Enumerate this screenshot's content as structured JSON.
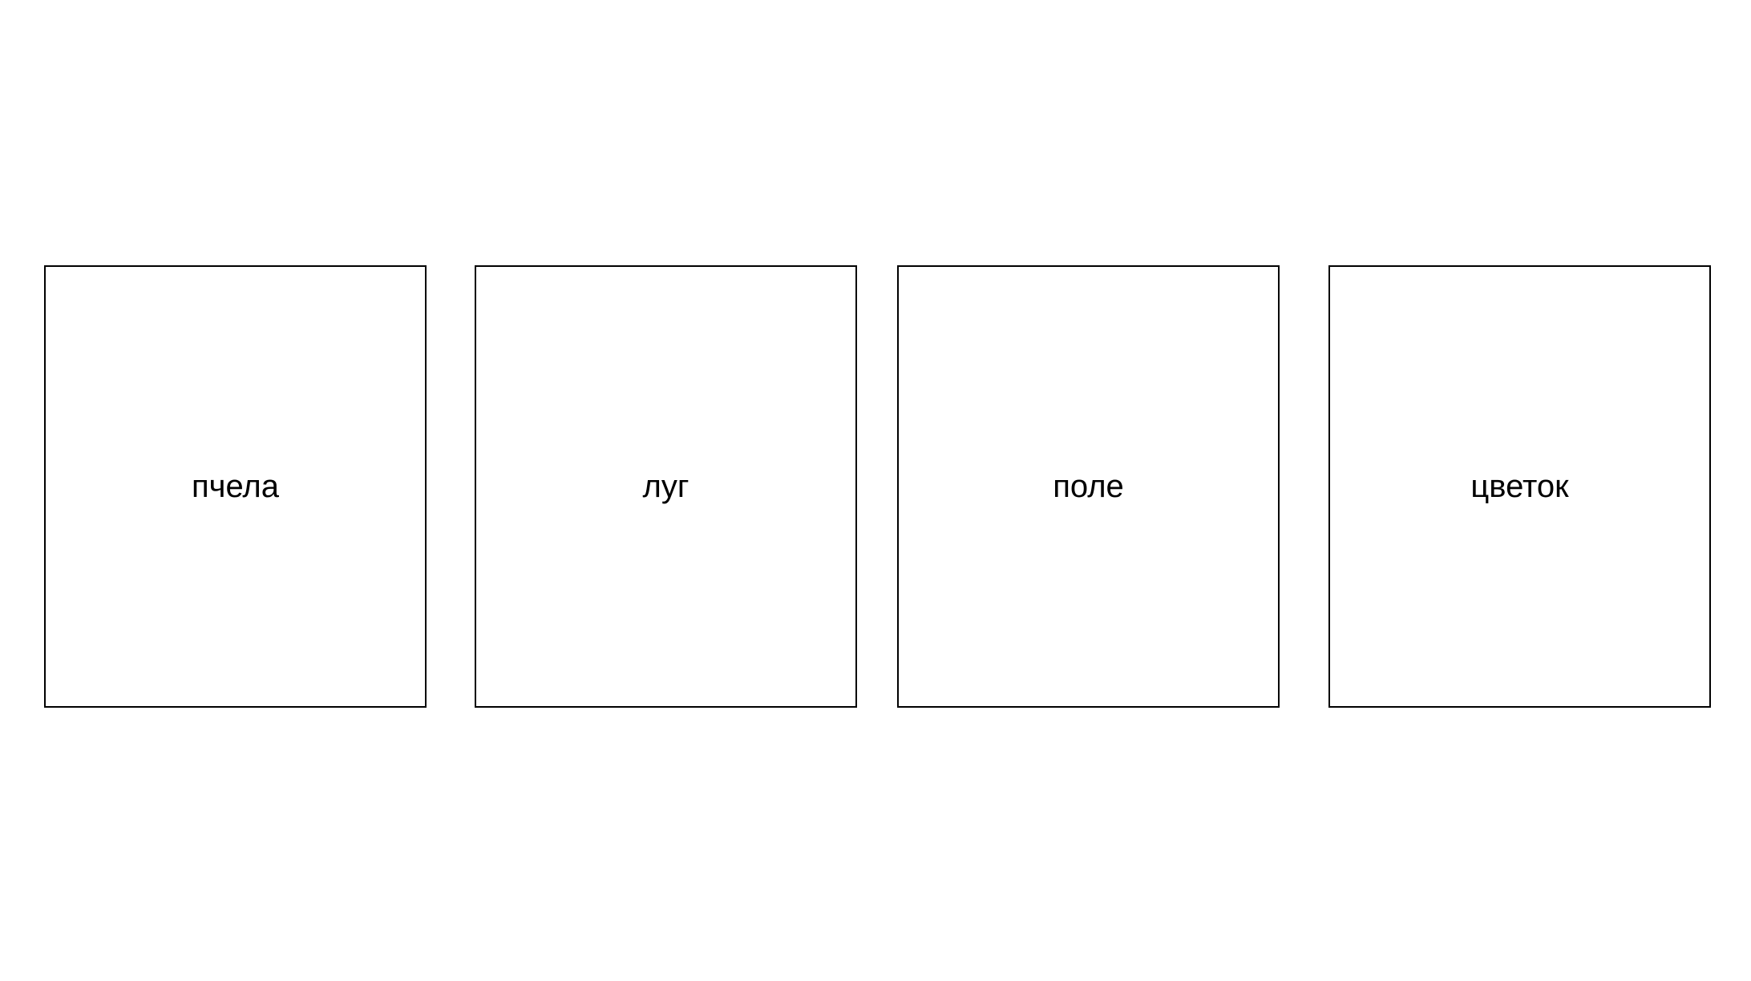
{
  "cards": [
    {
      "label": "пчела"
    },
    {
      "label": "луг"
    },
    {
      "label": "поле"
    },
    {
      "label": "цветок"
    }
  ],
  "colors": {
    "background": "#ffffff",
    "border": "#000000",
    "text": "#000000"
  }
}
